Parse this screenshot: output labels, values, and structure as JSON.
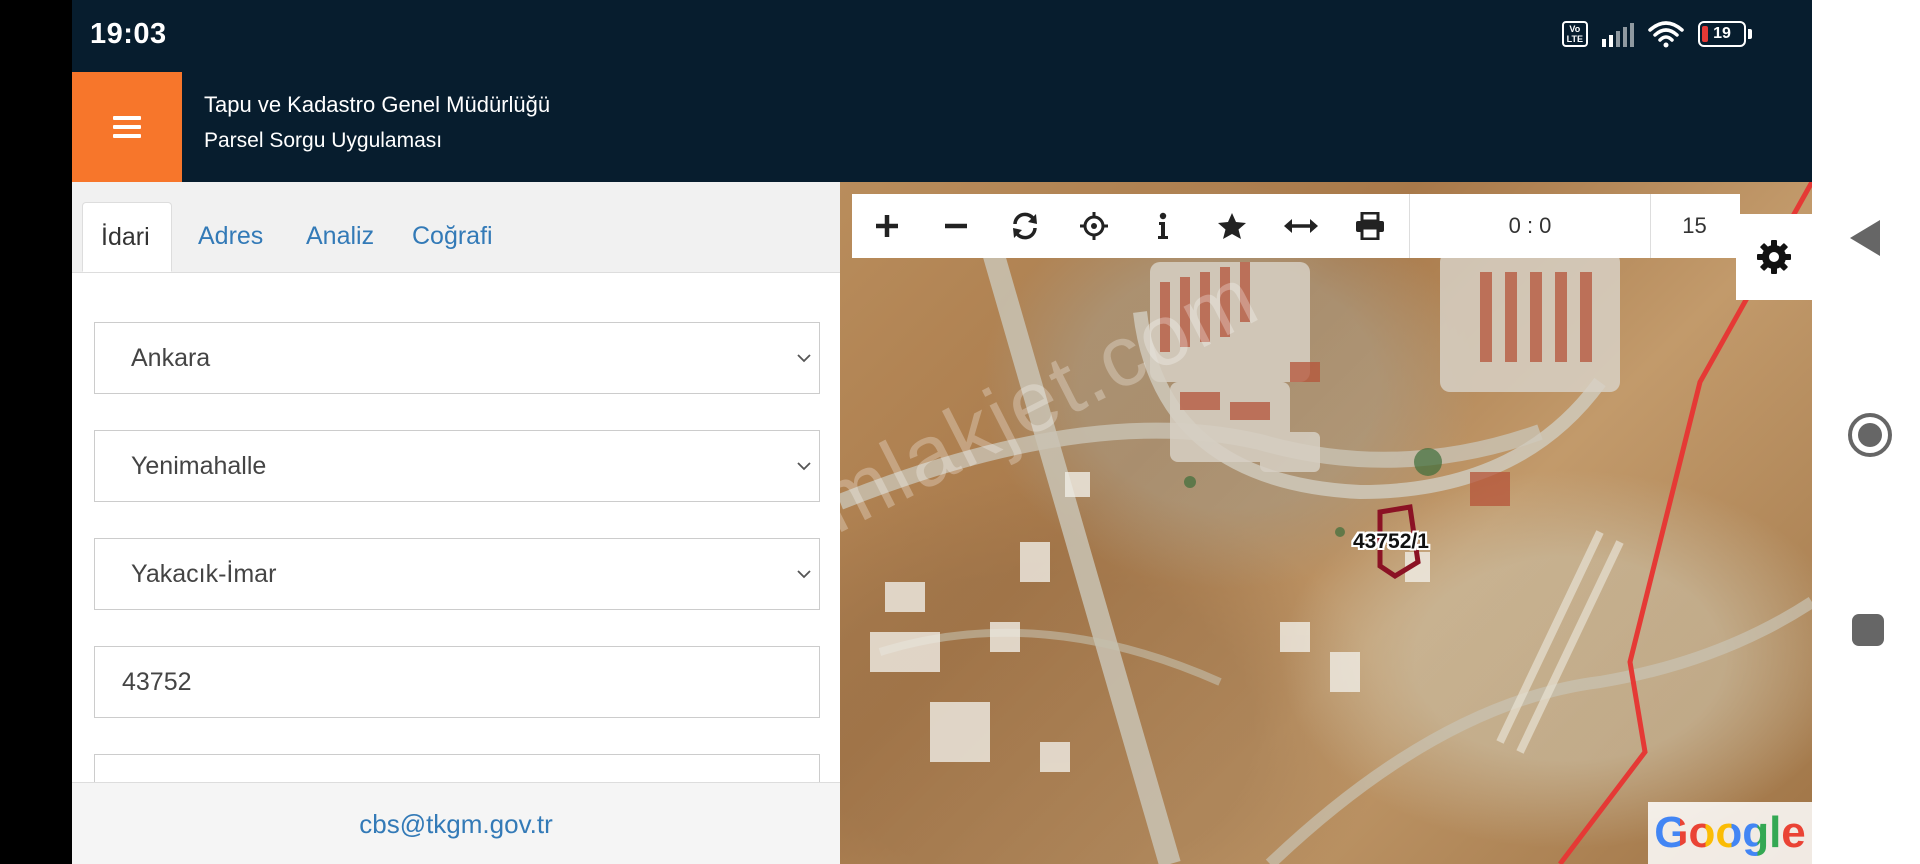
{
  "status_bar": {
    "time": "19:03",
    "volte_label": "Vo LTE",
    "battery": "19"
  },
  "header": {
    "title_line1": "Tapu ve Kadastro Genel Müdürlüğü",
    "title_line2": "Parsel Sorgu Uygulaması"
  },
  "tabs": [
    {
      "label": "İdari",
      "active": true
    },
    {
      "label": "Adres",
      "active": false
    },
    {
      "label": "Analiz",
      "active": false
    },
    {
      "label": "Coğrafi",
      "active": false
    }
  ],
  "form": {
    "province": "Ankara",
    "district": "Yenimahalle",
    "neighborhood": "Yakacık-İmar",
    "block_number": "43752"
  },
  "footer": {
    "email": "cbs@tkgm.gov.tr"
  },
  "map": {
    "toolbar_icons": [
      "zoom-in-icon",
      "zoom-out-icon",
      "refresh-icon",
      "locate-icon",
      "info-icon",
      "star-icon",
      "measure-icon",
      "print-icon"
    ],
    "coordinates": "0 : 0",
    "zoom_level": "15",
    "parcel_label": "43752/1",
    "watermark": "emlakjet.com",
    "attribution": "Google",
    "colors": {
      "parcel_outline": "#8b1224",
      "boundary_line": "#e53935"
    }
  },
  "colors": {
    "header_bg": "#071d2e",
    "menu_accent": "#f7762b",
    "link": "#337ab7"
  }
}
